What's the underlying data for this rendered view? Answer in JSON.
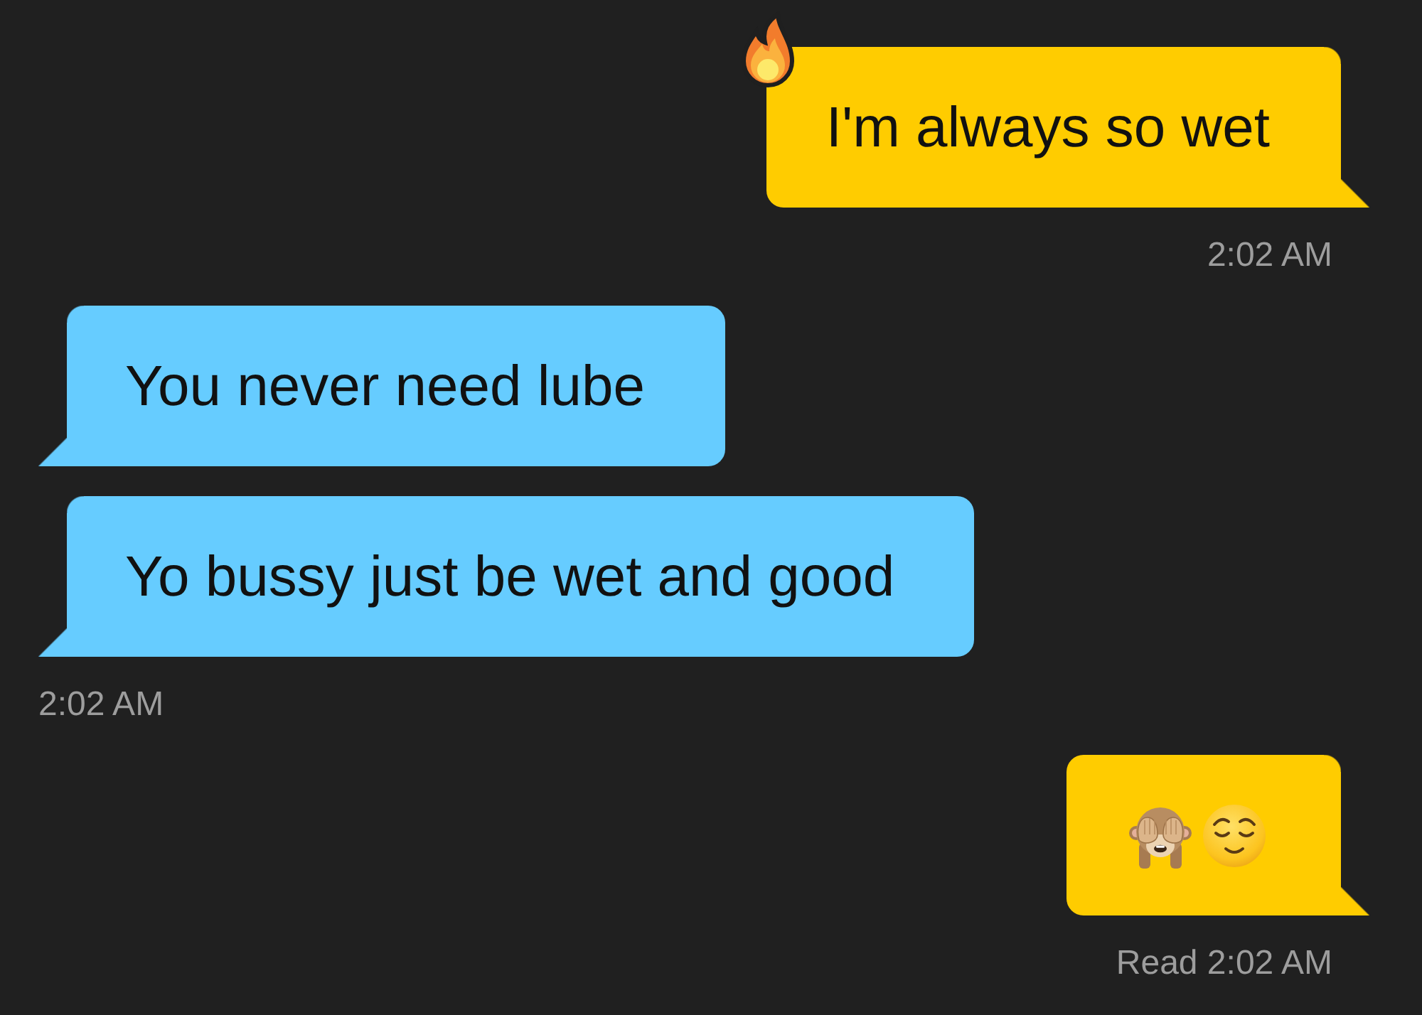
{
  "conversation": {
    "groups": [
      {
        "sent": true,
        "messages": [
          {
            "kind": "text",
            "text": "I'm always so wet",
            "reacted": true
          }
        ],
        "timestamp": "2:02 AM"
      },
      {
        "sent": false,
        "messages": [
          {
            "kind": "text",
            "text": "You never need lube",
            "reacted": false
          },
          {
            "kind": "text",
            "text": "Yo bussy just be wet and good",
            "reacted": false
          }
        ],
        "timestamp": "2:02 AM"
      },
      {
        "sent": true,
        "messages": [
          {
            "kind": "emoji",
            "emojis": [
              {
                "kind": "monkey"
              },
              {
                "kind": "relieved"
              }
            ],
            "reacted": false
          }
        ],
        "timestamp": "Read 2:02 AM"
      }
    ]
  }
}
